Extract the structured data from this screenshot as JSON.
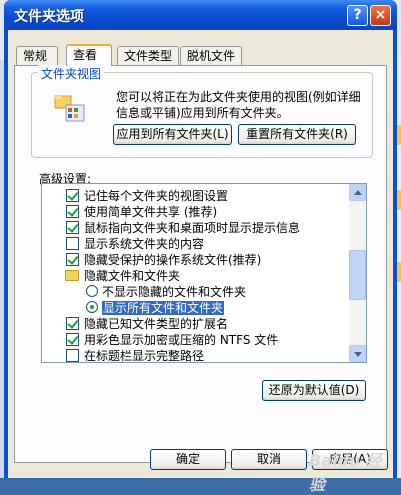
{
  "window": {
    "title": "文件夹选项",
    "help_label": "?",
    "close_label": "×"
  },
  "tabs": [
    {
      "label": "常规"
    },
    {
      "label": "查看"
    },
    {
      "label": "文件类型"
    },
    {
      "label": "脱机文件"
    }
  ],
  "folder_view": {
    "group_title": "文件夹视图",
    "description": "您可以将正在为此文件夹使用的视图(例如详细信息或平铺)应用到所有文件夹。",
    "apply_all_button": "应用到所有文件夹(L)",
    "reset_all_button": "重置所有文件夹(R)"
  },
  "advanced": {
    "label": "高级设置:",
    "items": [
      {
        "type": "checkbox",
        "checked": true,
        "label": "记住每个文件夹的视图设置"
      },
      {
        "type": "checkbox",
        "checked": true,
        "label": "使用简单文件共享 (推荐)"
      },
      {
        "type": "checkbox",
        "checked": true,
        "label": "鼠标指向文件夹和桌面项时显示提示信息"
      },
      {
        "type": "checkbox",
        "checked": false,
        "label": "显示系统文件夹的内容"
      },
      {
        "type": "checkbox",
        "checked": true,
        "label": "隐藏受保护的操作系统文件(推荐)"
      },
      {
        "type": "folder",
        "label": "隐藏文件和文件夹"
      },
      {
        "type": "radio",
        "checked": false,
        "label": "不显示隐藏的文件和文件夹"
      },
      {
        "type": "radio",
        "checked": true,
        "label": "显示所有文件和文件夹"
      },
      {
        "type": "checkbox",
        "checked": true,
        "label": "隐藏已知文件类型的扩展名"
      },
      {
        "type": "checkbox",
        "checked": true,
        "label": "用彩色显示加密或压缩的 NTFS 文件"
      },
      {
        "type": "checkbox",
        "checked": false,
        "label": "在标题栏显示完整路径"
      }
    ]
  },
  "restore_defaults_button": "还原为默认值(D)",
  "footer": {
    "ok": "确定",
    "cancel": "取消",
    "apply": "应用(A)"
  },
  "watermark": "Baidu 经验"
}
